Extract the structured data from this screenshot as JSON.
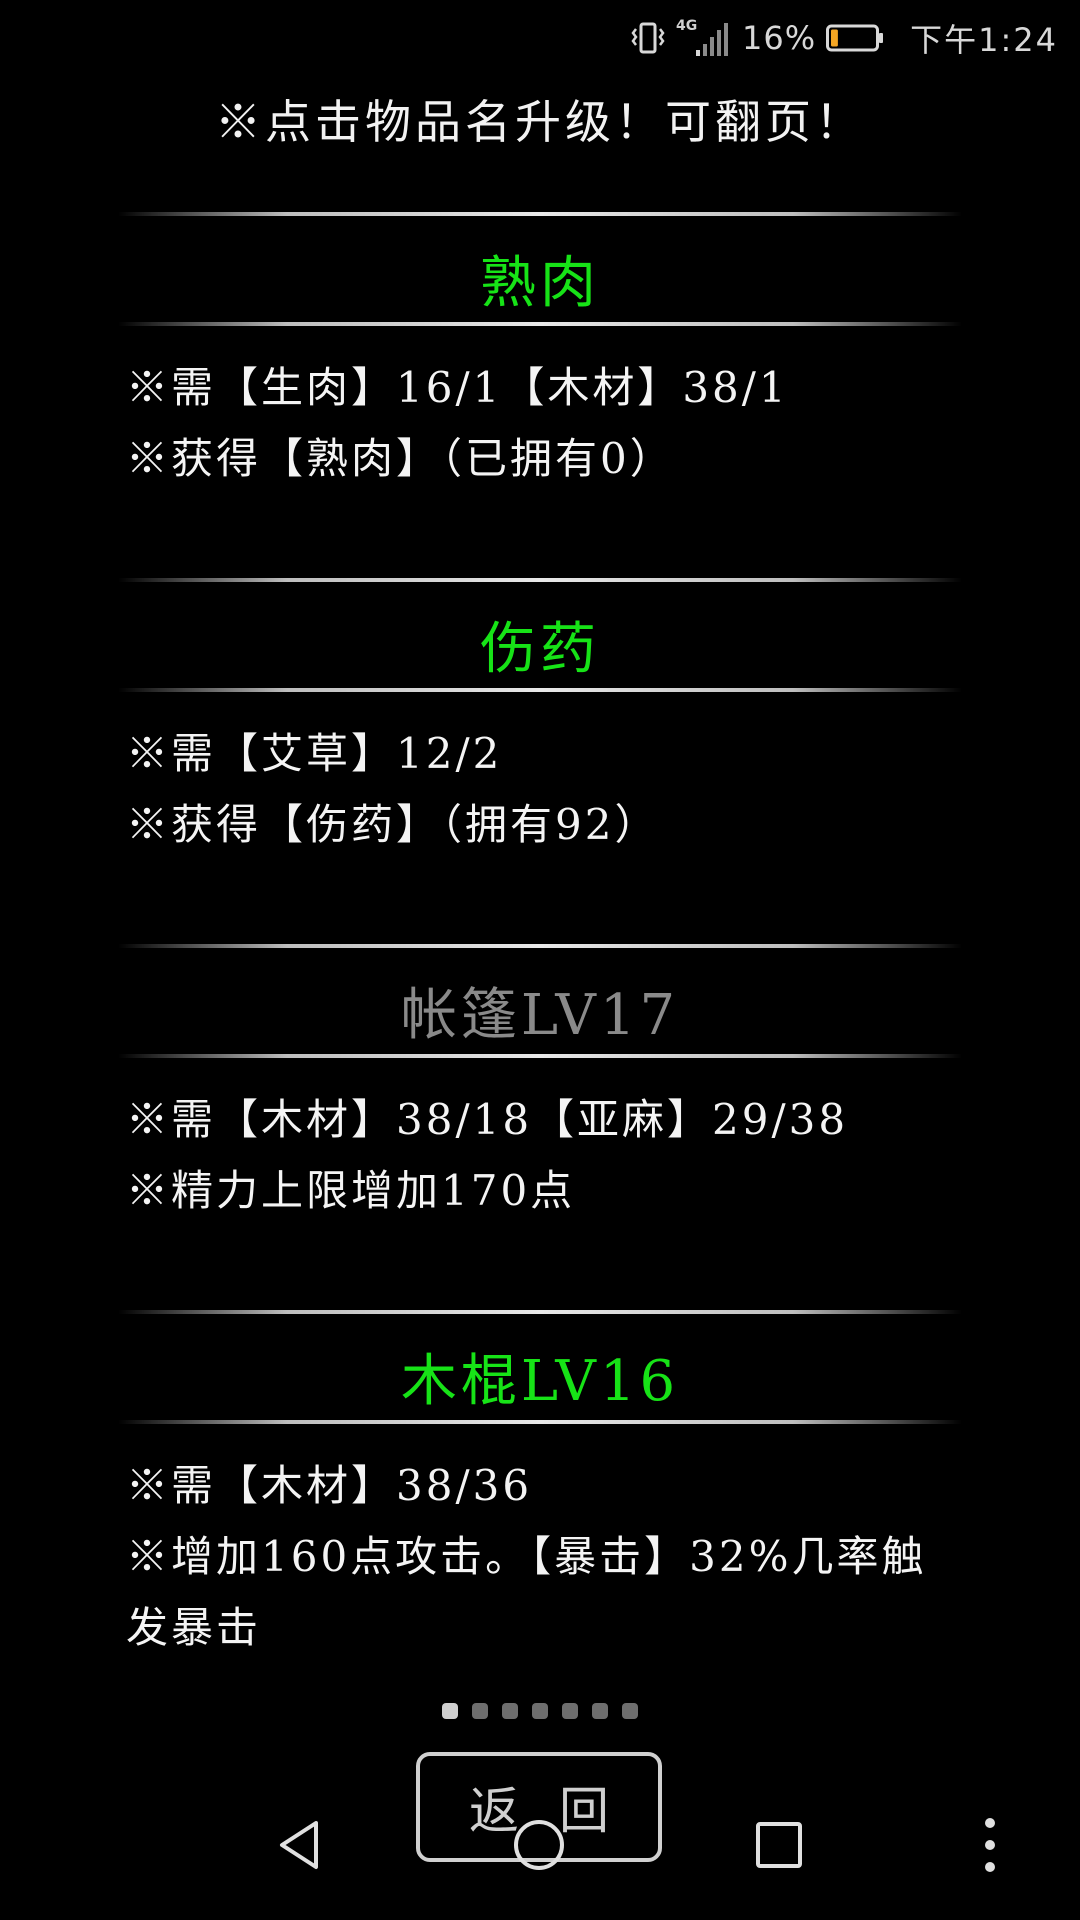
{
  "status_bar": {
    "network_type": "4G",
    "battery_percent": "16%",
    "battery_level": 0.16,
    "battery_color": "#f5a623",
    "time": "下午1:24",
    "icons": [
      "vibrate-icon",
      "signal-icon",
      "battery-icon"
    ]
  },
  "hint": "※点击物品名升级！可翻页！",
  "items": [
    {
      "title": "熟肉",
      "state": "active",
      "lines": [
        "※需【生肉】16/1【木材】38/1",
        "※获得【熟肉】（已拥有0）"
      ]
    },
    {
      "title": "伤药",
      "state": "active",
      "lines": [
        "※需【艾草】12/2",
        "※获得【伤药】（拥有92）"
      ]
    },
    {
      "title": "帐篷LV17",
      "state": "inactive",
      "lines": [
        "※需【木材】38/18【亚麻】29/38",
        "※精力上限增加170点"
      ]
    },
    {
      "title": "木棍LV16",
      "state": "active",
      "lines": [
        "※需【木材】38/36",
        "※增加160点攻击。【暴击】32%几率触发暴击"
      ]
    }
  ],
  "pagination": {
    "total_pages": 7,
    "current_page": 1
  },
  "back_button": "返回",
  "colors": {
    "active_title": "#17e317",
    "inactive_title": "#8a8a8a",
    "background": "#000000"
  },
  "nav_bar": {
    "icons": [
      "nav-back-icon",
      "nav-home-icon",
      "nav-recent-icon",
      "nav-menu-icon"
    ]
  }
}
